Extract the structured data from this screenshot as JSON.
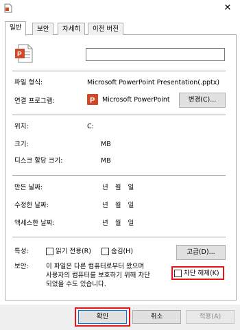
{
  "tabs": [
    "일반",
    "보안",
    "자세히",
    "이전 버전"
  ],
  "fields": {
    "file_type_label": "파일 형식:",
    "file_type_value": "Microsoft PowerPoint Presentation(.pptx)",
    "opens_with_label": "연결 프로그램:",
    "opens_with_value": "Microsoft PowerPoint",
    "change_button": "변경(C)...",
    "location_label": "위치:",
    "location_value": "C:",
    "size_label": "크기:",
    "size_value": "MB",
    "size_on_disk_label": "디스크 할당 크기:",
    "size_on_disk_value": "MB",
    "created_label": "만든 날짜:",
    "modified_label": "수정한 날짜:",
    "accessed_label": "액세스한 날짜:",
    "date_value": "년  월  일",
    "attributes_label": "특성:",
    "readonly_label": "읽기 전용(R)",
    "hidden_label": "숨김(H)",
    "advanced_button": "고급(D)...",
    "security_label": "보안:",
    "security_text_1": "이 파일은 다른 컴퓨터로부터 왔으며",
    "security_text_2": "사용자의 컴퓨터를 보호하기 위해 차단",
    "security_text_3": "되었을 수도 있습니다.",
    "unblock_label": "차단 해제(K)",
    "name_value": ""
  },
  "footer": {
    "ok": "확인",
    "cancel": "취소",
    "apply": "적용(A)"
  },
  "colors": {
    "highlight": "#e8141a",
    "powerpoint": "#d24726"
  }
}
